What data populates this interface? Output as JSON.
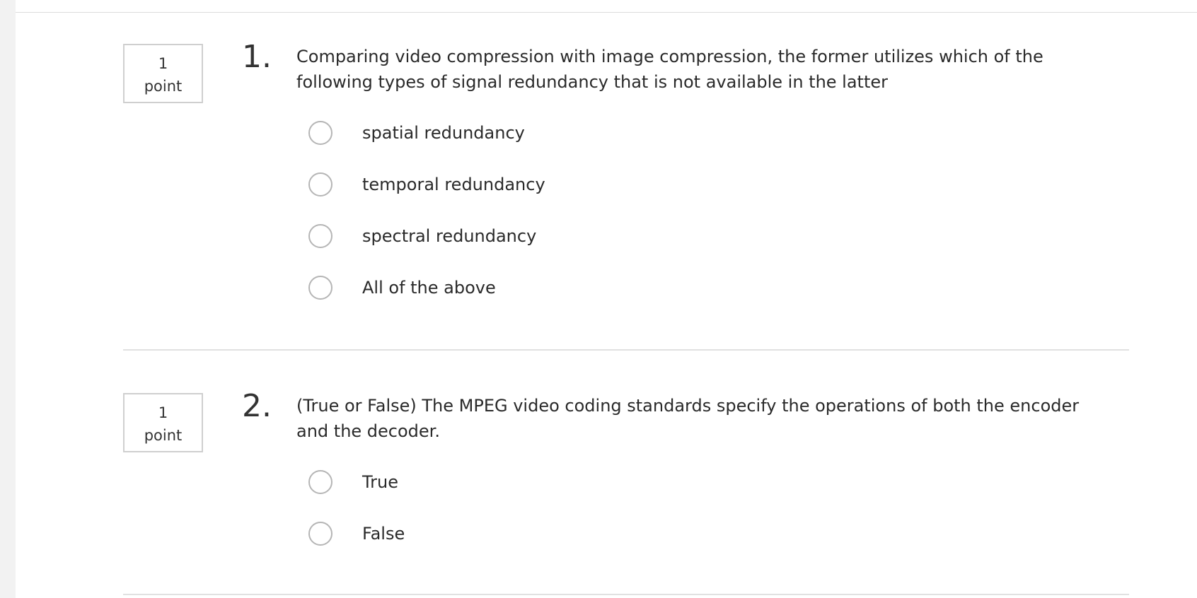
{
  "questions": [
    {
      "points_value": "1",
      "points_unit": "point",
      "number": "1.",
      "text": "Comparing video compression with image compression, the former utilizes which of the following types of signal redundancy that is not available in the latter",
      "options": [
        {
          "label": "spatial redundancy",
          "selected": false
        },
        {
          "label": "temporal redundancy",
          "selected": false
        },
        {
          "label": "spectral redundancy",
          "selected": false
        },
        {
          "label": "All of the above",
          "selected": false
        }
      ]
    },
    {
      "points_value": "1",
      "points_unit": "point",
      "number": "2.",
      "text": "(True or False) The MPEG video coding standards specify the operations of both the encoder and the decoder.",
      "options": [
        {
          "label": "True",
          "selected": false
        },
        {
          "label": "False",
          "selected": false
        }
      ]
    }
  ],
  "colors": {
    "radio_border": "#b5b5b5",
    "divider": "#e1e1e1",
    "text": "#2a2a2a"
  }
}
